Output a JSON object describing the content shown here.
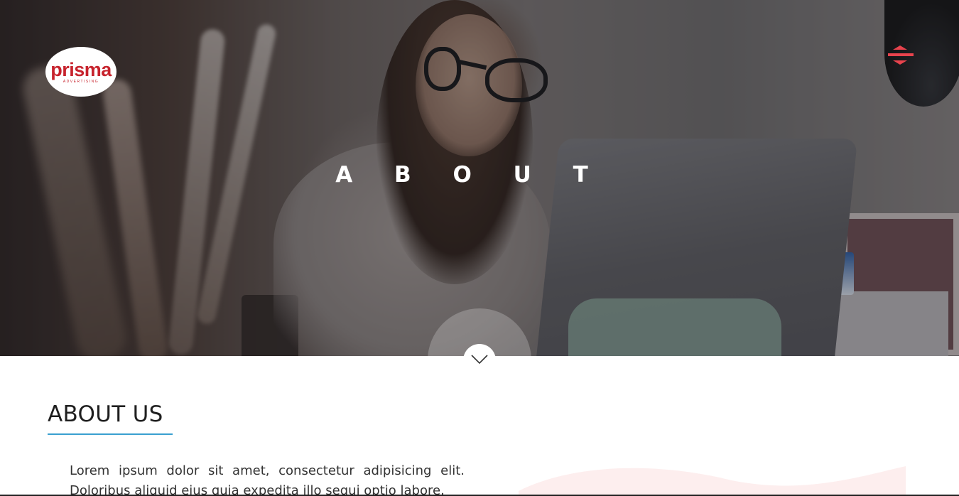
{
  "brand": {
    "logo_text": "prisma",
    "logo_subtext": "ADVERTISING",
    "logo_color": "#c7232d"
  },
  "header": {
    "menu_icon": "hamburger-menu-icon",
    "menu_color": "#e8434d"
  },
  "hero": {
    "title": "A B O U T",
    "scroll_icon": "chevron-down-icon"
  },
  "about": {
    "heading": "ABOUT US",
    "underline_color": "#3aa0d0",
    "body": "Lorem ipsum dolor sit amet, consectetur adipisicing elit. Doloribus aliquid eius quia expedita illo sequi optio labore."
  }
}
